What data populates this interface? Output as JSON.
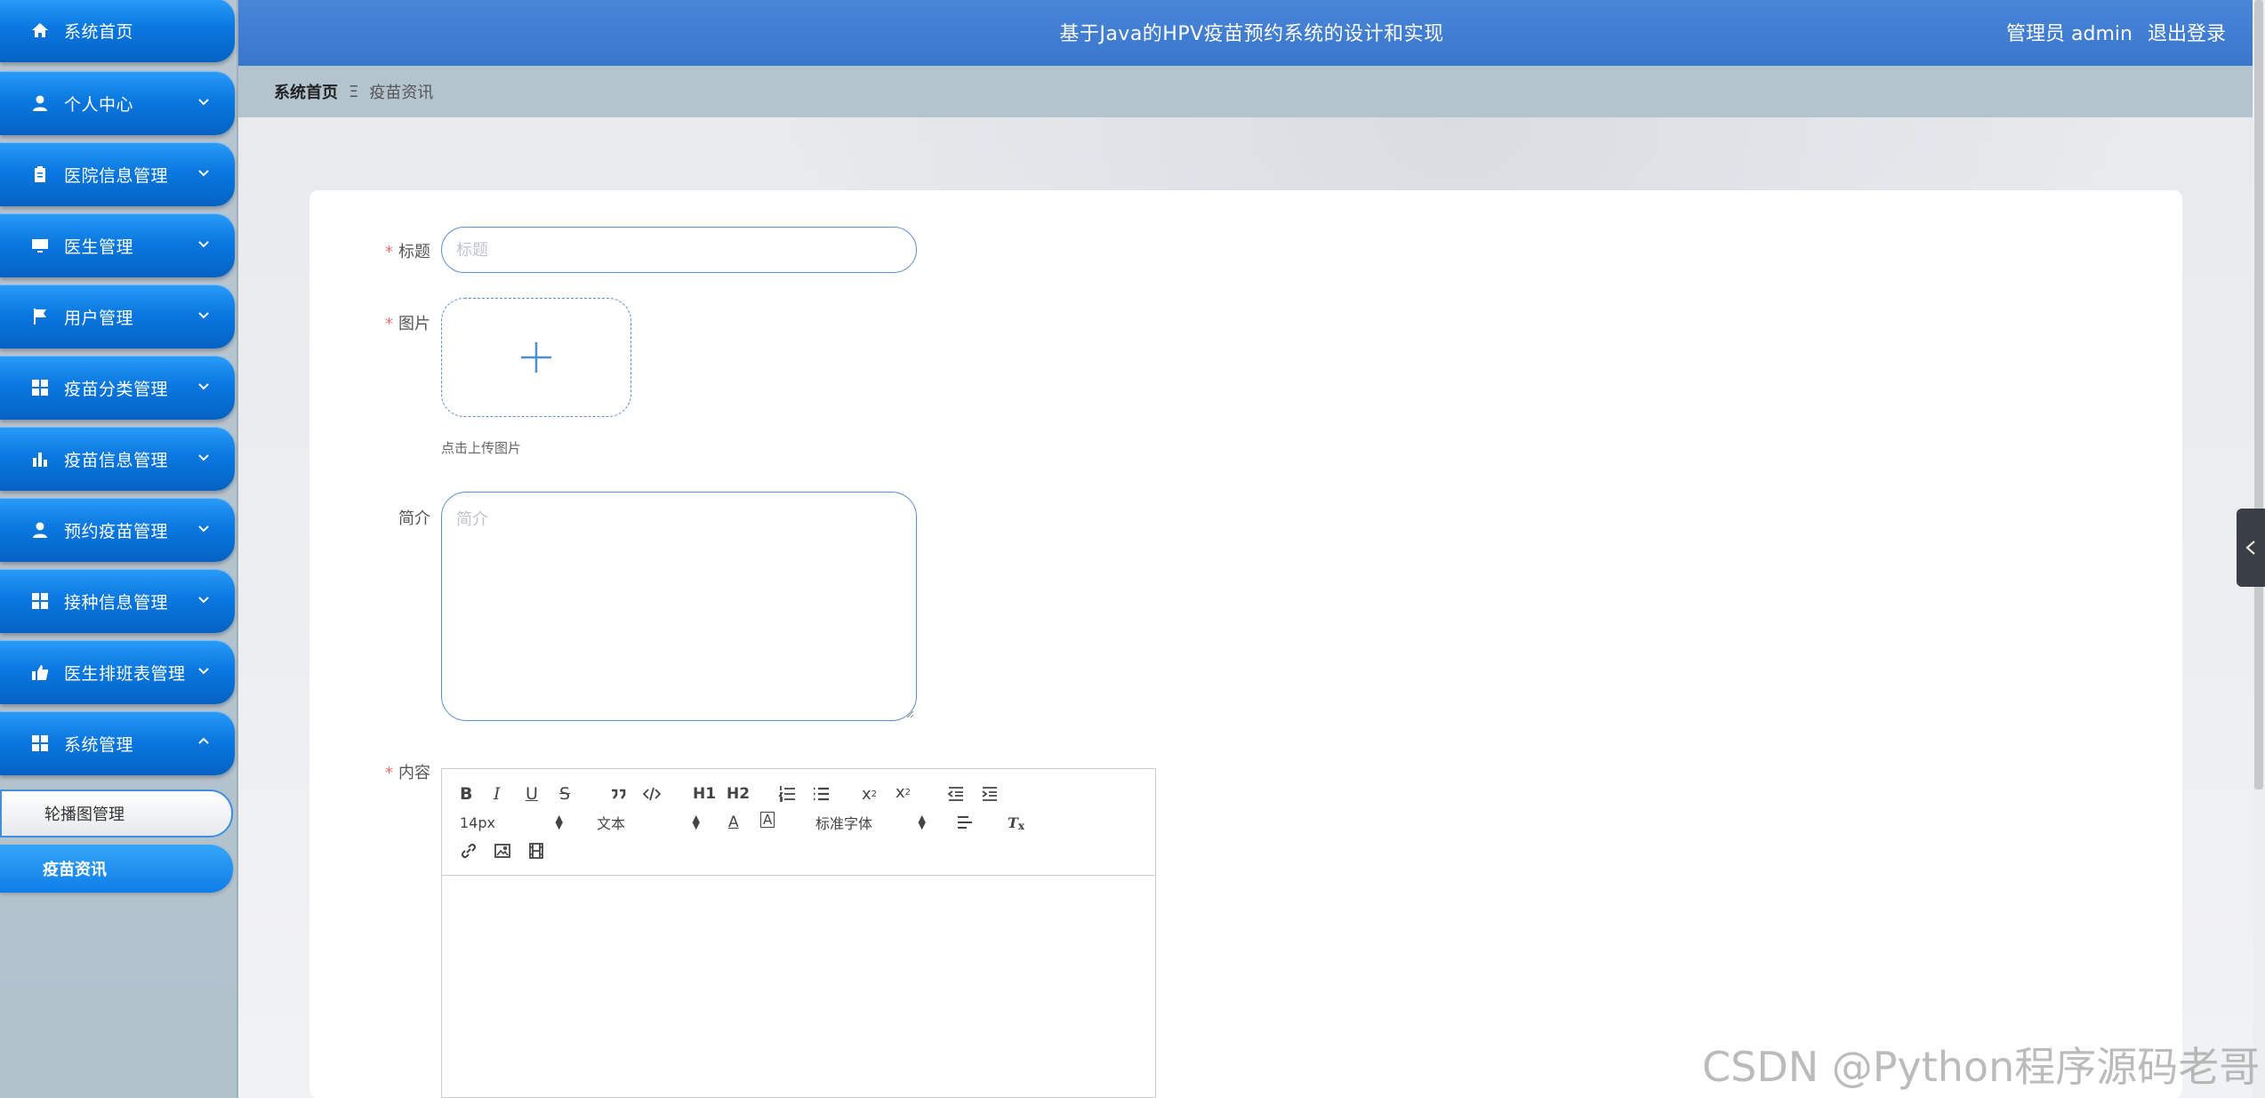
{
  "header": {
    "title": "基于Java的HPV疫苗预约系统的设计和实现",
    "user_label": "管理员 admin",
    "logout_label": "退出登录"
  },
  "breadcrumb": {
    "home": "系统首页",
    "separator": "Ξ",
    "current": "疫苗资讯"
  },
  "sidebar": {
    "items": [
      {
        "label": "系统首页",
        "icon": "home-icon"
      },
      {
        "label": "个人中心",
        "icon": "user-icon"
      },
      {
        "label": "医院信息管理",
        "icon": "clipboard-icon"
      },
      {
        "label": "医生管理",
        "icon": "monitor-icon"
      },
      {
        "label": "用户管理",
        "icon": "flag-icon"
      },
      {
        "label": "疫苗分类管理",
        "icon": "grid-icon"
      },
      {
        "label": "疫苗信息管理",
        "icon": "bar-chart-icon"
      },
      {
        "label": "预约疫苗管理",
        "icon": "user-icon"
      },
      {
        "label": "接种信息管理",
        "icon": "grid-icon"
      },
      {
        "label": "医生排班表管理",
        "icon": "thumbs-up-icon"
      },
      {
        "label": "系统管理",
        "icon": "grid-icon"
      }
    ],
    "subitems": [
      {
        "label": "轮播图管理"
      },
      {
        "label": "疫苗资讯"
      }
    ]
  },
  "form": {
    "title_label": "标题",
    "title_placeholder": "标题",
    "image_label": "图片",
    "upload_tip": "点击上传图片",
    "intro_label": "简介",
    "intro_placeholder": "简介",
    "content_label": "内容"
  },
  "editor": {
    "h1": "H1",
    "h2": "H2",
    "size_value": "14px",
    "format_value": "文本",
    "font_value": "标准字体"
  },
  "watermark": "CSDN @Python程序源码老哥",
  "colors": {
    "accent": "#0a78e0",
    "header": "#3f7dd2",
    "required": "#f56c6c"
  }
}
